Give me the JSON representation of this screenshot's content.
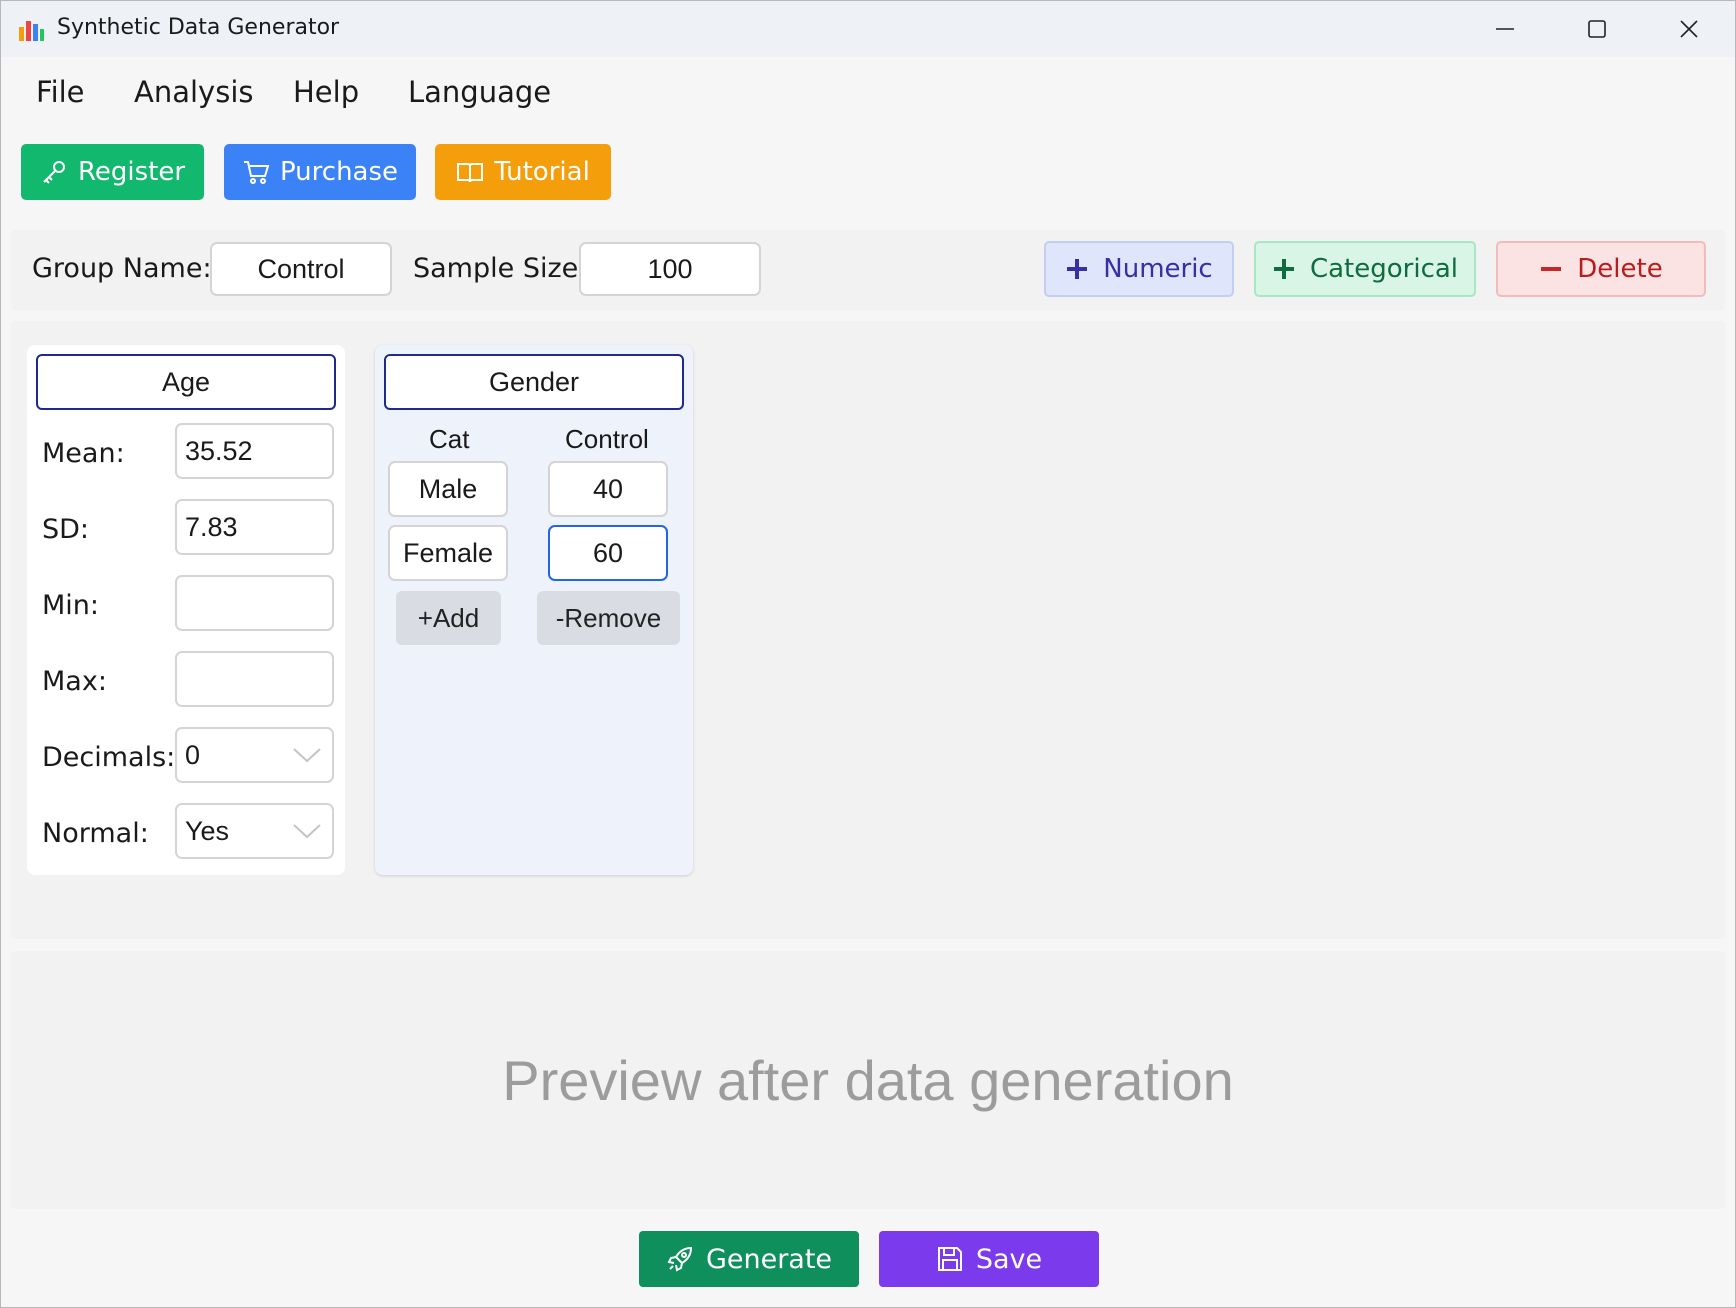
{
  "window": {
    "title": "Synthetic Data Generator",
    "icons": [
      "bar-chart-icon",
      "minimize-icon",
      "maximize-icon",
      "close-icon"
    ]
  },
  "menu": {
    "file": "File",
    "analysis": "Analysis",
    "help": "Help",
    "language": "Language"
  },
  "toolbar": {
    "register": "Register",
    "purchase": "Purchase",
    "tutorial": "Tutorial",
    "colors": {
      "register": "#12b86e",
      "purchase": "#3b82f6",
      "tutorial": "#f59e0b"
    }
  },
  "group": {
    "name_label": "Group Name:",
    "name_value": "Control",
    "size_label": "Sample Size:",
    "size_value": "100"
  },
  "actions": {
    "numeric": "Numeric",
    "categorical": "Categorical",
    "delete": "Delete"
  },
  "numeric_var": {
    "name": "Age",
    "mean_label": "Mean:",
    "mean_value": "35.52",
    "sd_label": "SD:",
    "sd_value": "7.83",
    "min_label": "Min:",
    "min_value": "",
    "max_label": "Max:",
    "max_value": "",
    "decimals_label": "Decimals:",
    "decimals_value": "0",
    "normal_label": "Normal:",
    "normal_value": "Yes"
  },
  "categorical_var": {
    "name": "Gender",
    "col_cat": "Cat",
    "col_group": "Control",
    "rows": [
      {
        "cat": "Male",
        "value": "40"
      },
      {
        "cat": "Female",
        "value": "60"
      }
    ],
    "add": "+Add",
    "remove": "-Remove"
  },
  "preview": {
    "placeholder": "Preview after data generation"
  },
  "bottom": {
    "generate": "Generate",
    "save": "Save",
    "colors": {
      "generate": "#0e8f5b",
      "save": "#7c3aed"
    }
  }
}
